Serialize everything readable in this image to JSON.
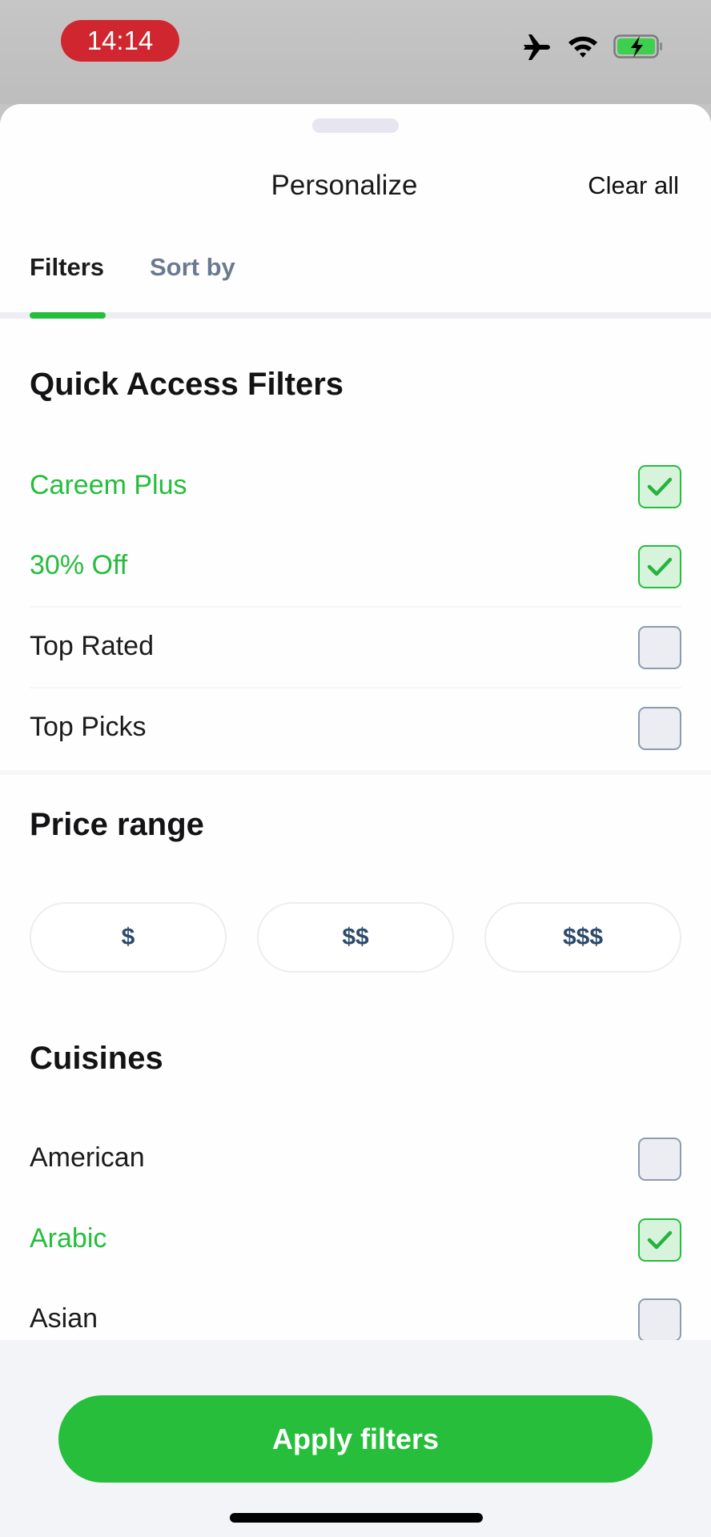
{
  "status_bar": {
    "time": "14:14",
    "icons": [
      "airplane-icon",
      "wifi-icon",
      "battery-charging-icon"
    ],
    "time_pill_color": "#d0262f",
    "battery_color": "#3ecf4f"
  },
  "sheet": {
    "title": "Personalize",
    "clear_all_label": "Clear all"
  },
  "tabs": [
    {
      "label": "Filters",
      "active": true
    },
    {
      "label": "Sort by",
      "active": false
    }
  ],
  "quick_access": {
    "title": "Quick Access Filters",
    "items": [
      {
        "label": "Careem Plus",
        "checked": true
      },
      {
        "label": "30% Off",
        "checked": true
      },
      {
        "label": "Top Rated",
        "checked": false
      },
      {
        "label": "Top Picks",
        "checked": false
      }
    ]
  },
  "price_range": {
    "title": "Price range",
    "options": [
      "$",
      "$$",
      "$$$"
    ]
  },
  "cuisines": {
    "title": "Cuisines",
    "items": [
      {
        "label": "American",
        "checked": false
      },
      {
        "label": "Arabic",
        "checked": true
      },
      {
        "label": "Asian",
        "checked": false
      }
    ]
  },
  "footer": {
    "apply_label": "Apply filters"
  },
  "colors": {
    "accent": "#24be3c",
    "text": "#1c1c1e",
    "inactive_tab": "#6b7a90",
    "price_text": "#2c4a6d"
  }
}
